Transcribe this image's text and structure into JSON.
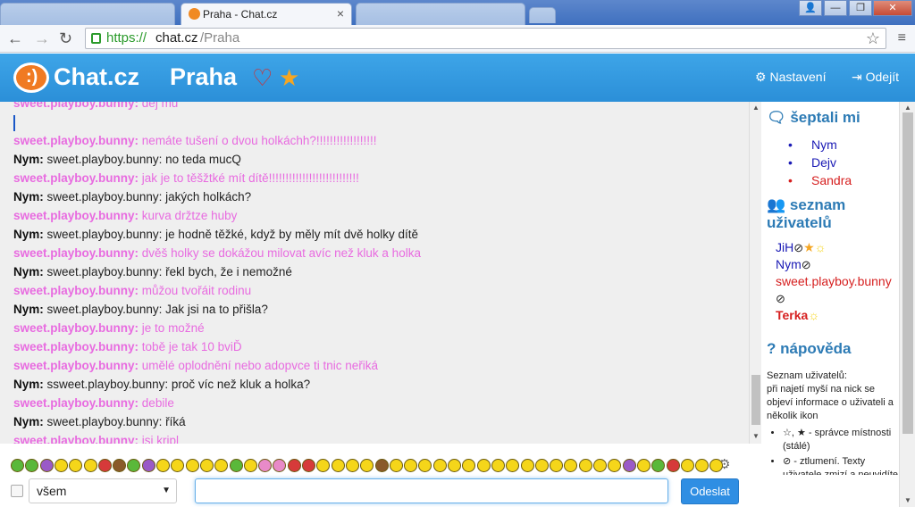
{
  "browser": {
    "tabs": [
      {
        "label": ""
      },
      {
        "label": "Praha - Chat.cz",
        "close": "×"
      },
      {
        "label": ""
      }
    ],
    "window_controls": {
      "user": "👤",
      "minimize": "—",
      "maximize": "❐",
      "close": "✕"
    },
    "url": {
      "scheme": "https://",
      "host": "chat.cz",
      "path": "/Praha"
    },
    "nav": {
      "back": "←",
      "forward": "→",
      "reload": "↻",
      "menu": "≡",
      "bookmark": "☆"
    }
  },
  "header": {
    "brand": "Chat.cz",
    "logo_glyph": ":)",
    "room": "Praha",
    "heart": "♡",
    "star": "★",
    "settings_label": "Nastavení",
    "settings_icon": "⚙",
    "logout_label": "Odejít",
    "logout_icon": "⇥"
  },
  "messages": [
    {
      "nick": "sweet.playboy.bunny:",
      "text": "dej mu",
      "kind": "bunny"
    },
    {
      "nick": "sweet.playboy.bunny:",
      "text": "nemáte tušení o dvou holkáchh?!!!!!!!!!!!!!!!!!!",
      "kind": "bunny"
    },
    {
      "nick": "Nym:",
      "text": "sweet.playboy.bunny: no teda mucQ",
      "kind": "nym"
    },
    {
      "nick": "sweet.playboy.bunny:",
      "text": "jak je to těšžtké mít dítě!!!!!!!!!!!!!!!!!!!!!!!!!!!",
      "kind": "bunny"
    },
    {
      "nick": "Nym:",
      "text": "sweet.playboy.bunny: jakých holkách?",
      "kind": "nym"
    },
    {
      "nick": "sweet.playboy.bunny:",
      "text": "kurva držtze huby",
      "kind": "bunny"
    },
    {
      "nick": "Nym:",
      "text": "sweet.playboy.bunny: je hodně těžké, když by měly mít dvě holky dítě",
      "kind": "nym"
    },
    {
      "nick": "sweet.playboy.bunny:",
      "text": "dvěš holky se dokážou milovat avíc než kluk a holka",
      "kind": "bunny"
    },
    {
      "nick": "Nym:",
      "text": "sweet.playboy.bunny: řekl bych, že i nemožné",
      "kind": "nym"
    },
    {
      "nick": "sweet.playboy.bunny:",
      "text": "můžou tvořáit rodinu",
      "kind": "bunny"
    },
    {
      "nick": "Nym:",
      "text": "sweet.playboy.bunny: Jak jsi na to přišla?",
      "kind": "nym"
    },
    {
      "nick": "sweet.playboy.bunny:",
      "text": "je to možné",
      "kind": "bunny"
    },
    {
      "nick": "sweet.playboy.bunny:",
      "text": "tobě je tak 10 bviĎ",
      "kind": "bunny"
    },
    {
      "nick": "sweet.playboy.bunny:",
      "text": "umělé oplodnění nebo adopvce ti tnic neřiká",
      "kind": "bunny"
    },
    {
      "nick": "Nym:",
      "text": "ssweet.playboy.bunny: proč víc než kluk a holka?",
      "kind": "nym"
    },
    {
      "nick": "sweet.playboy.bunny:",
      "text": "debile",
      "kind": "bunny"
    },
    {
      "nick": "Nym:",
      "text": "sweet.playboy.bunny: říká",
      "kind": "nym"
    },
    {
      "nick": "sweet.playboy.bunny:",
      "text": "jsi kripl",
      "kind": "bunny"
    }
  ],
  "sidebar": {
    "whisper_title": "šeptali mi",
    "whisper_icon": "🗨",
    "whispers": [
      {
        "name": "Nym",
        "color": "#1a1ab5"
      },
      {
        "name": "Dejv",
        "color": "#1a1ab5"
      },
      {
        "name": "Sandra",
        "color": "#d61f1f"
      }
    ],
    "users_title": "seznam uživatelů",
    "users_icon": "👥",
    "users": {
      "jih": "JiH",
      "nym": "Nym",
      "bunny": "sweet.playboy.bunny",
      "terka": "Terka"
    },
    "badges": {
      "ban": "⊘",
      "sun": "☼",
      "star": "★"
    },
    "help_title": "nápověda",
    "help_icon": "?",
    "help_heading": "Seznam uživatelů:",
    "help_text": "při najetí myší na nick se objeví informace o uživateli a několik ikon",
    "help_items": [
      "☆, ★ - správce místnosti (stálé)",
      "⊘ - ztlumení. Texty uživatele zmizí a neuvidíte ani jeho šeptání. Nick ztlumeného uživatele je přeškrtnutý"
    ]
  },
  "composer": {
    "target_value": "všem",
    "input_value": "",
    "send_label": "Odeslat",
    "emoji_settings_icon": "⚙"
  }
}
